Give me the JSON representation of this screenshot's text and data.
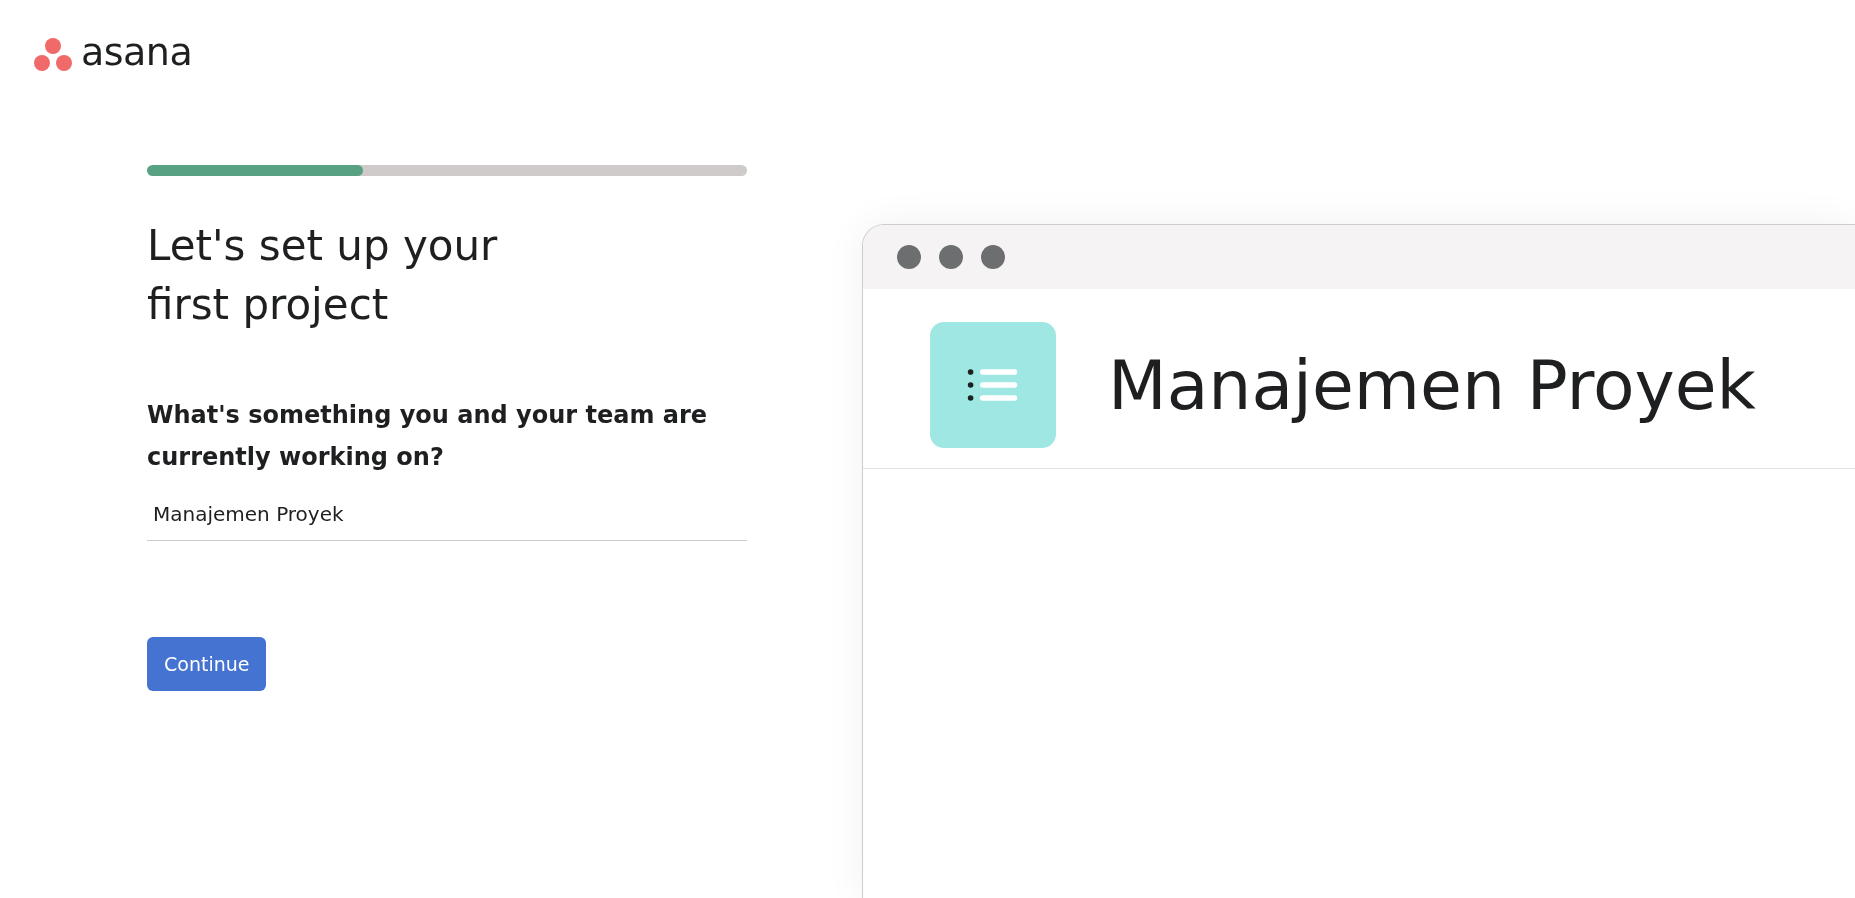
{
  "logo": {
    "text": "asana"
  },
  "progress": {
    "level": 0.36
  },
  "heading": "Let's set up your first project",
  "question": "What's something you and your team are currently working on?",
  "project_field": {
    "value": "Manajemen Proyek"
  },
  "continue_button": {
    "label": "Continue"
  },
  "preview": {
    "project_title": "Manajemen Proyek"
  }
}
